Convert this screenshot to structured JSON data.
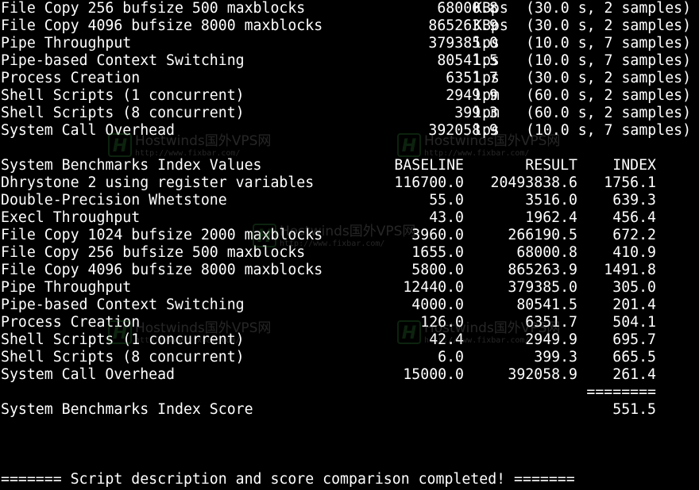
{
  "terminal": {
    "results": [
      {
        "label": "File Copy 256 bufsize 500 maxblocks",
        "value": "68000.8",
        "unit": "KBps",
        "note": "(30.0 s, 2 samples)"
      },
      {
        "label": "File Copy 4096 bufsize 8000 maxblocks",
        "value": "865263.9",
        "unit": "KBps",
        "note": "(30.0 s, 2 samples)"
      },
      {
        "label": "Pipe Throughput",
        "value": "379385.0",
        "unit": "lps",
        "note": "(10.0 s, 7 samples)"
      },
      {
        "label": "Pipe-based Context Switching",
        "value": "80541.5",
        "unit": "lps",
        "note": "(10.0 s, 7 samples)"
      },
      {
        "label": "Process Creation",
        "value": "6351.7",
        "unit": "lps",
        "note": "(30.0 s, 2 samples)"
      },
      {
        "label": "Shell Scripts (1 concurrent)",
        "value": "2949.9",
        "unit": "lpm",
        "note": "(60.0 s, 2 samples)"
      },
      {
        "label": "Shell Scripts (8 concurrent)",
        "value": "399.3",
        "unit": "lpm",
        "note": "(60.0 s, 2 samples)"
      },
      {
        "label": "System Call Overhead",
        "value": "392058.9",
        "unit": "lps",
        "note": "(10.0 s, 7 samples)"
      }
    ],
    "index_header": {
      "label": "System Benchmarks Index Values",
      "baseline": "BASELINE",
      "result": "RESULT",
      "index": "INDEX"
    },
    "index_rows": [
      {
        "label": "Dhrystone 2 using register variables",
        "baseline": "116700.0",
        "result": "20493838.6",
        "index": "1756.1"
      },
      {
        "label": "Double-Precision Whetstone",
        "baseline": "55.0",
        "result": "3516.0",
        "index": "639.3"
      },
      {
        "label": "Execl Throughput",
        "baseline": "43.0",
        "result": "1962.4",
        "index": "456.4"
      },
      {
        "label": "File Copy 1024 bufsize 2000 maxblocks",
        "baseline": "3960.0",
        "result": "266190.5",
        "index": "672.2"
      },
      {
        "label": "File Copy 256 bufsize 500 maxblocks",
        "baseline": "1655.0",
        "result": "68000.8",
        "index": "410.9"
      },
      {
        "label": "File Copy 4096 bufsize 8000 maxblocks",
        "baseline": "5800.0",
        "result": "865263.9",
        "index": "1491.8"
      },
      {
        "label": "Pipe Throughput",
        "baseline": "12440.0",
        "result": "379385.0",
        "index": "305.0"
      },
      {
        "label": "Pipe-based Context Switching",
        "baseline": "4000.0",
        "result": "80541.5",
        "index": "201.4"
      },
      {
        "label": "Process Creation",
        "baseline": "126.0",
        "result": "6351.7",
        "index": "504.1"
      },
      {
        "label": "Shell Scripts (1 concurrent)",
        "baseline": "42.4",
        "result": "2949.9",
        "index": "695.7"
      },
      {
        "label": "Shell Scripts (8 concurrent)",
        "baseline": "6.0",
        "result": "399.3",
        "index": "665.5"
      },
      {
        "label": "System Call Overhead",
        "baseline": "15000.0",
        "result": "392058.9",
        "index": "261.4"
      }
    ],
    "score_separator": "========",
    "score_label": "System Benchmarks Index Score",
    "score_value": "551.5",
    "completion_message": "======= Script description and score comparison completed! ======="
  },
  "watermark": {
    "logo_letter": "H",
    "brand": "Hostwinds国外VPS网",
    "url": "http://www.fixbar.com/"
  },
  "colors": {
    "background": "#000000",
    "text": "#ffffff",
    "watermark_green": "#2e7d32"
  }
}
